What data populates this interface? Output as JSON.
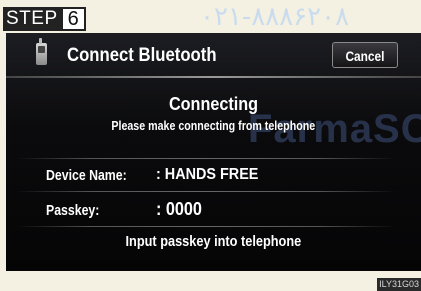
{
  "step": {
    "label": "STEP",
    "number": "6"
  },
  "overlay_phone": "۰۲۱-۸۸۸۶۲۰۸",
  "screen": {
    "title": "Connect Bluetooth",
    "cancel_label": "Cancel",
    "status_title": "Connecting",
    "status_message": "Please make connecting from telephone",
    "watermark": "FarmaSC",
    "device_name_label": "Device Name:",
    "device_name_value": ": HANDS FREE",
    "passkey_label": "Passkey:",
    "passkey_value": ": 0000",
    "instruction": "Input passkey into telephone"
  },
  "image_code": "ILY31G03",
  "colors": {
    "screen_bg": "#0b0b0d",
    "page_bg": "#f4f1e2",
    "text": "#ffffff",
    "overlay_phone": "#c9dcef",
    "watermark": "#27324a"
  },
  "icons": {
    "phone": "mobile-phone-icon"
  }
}
